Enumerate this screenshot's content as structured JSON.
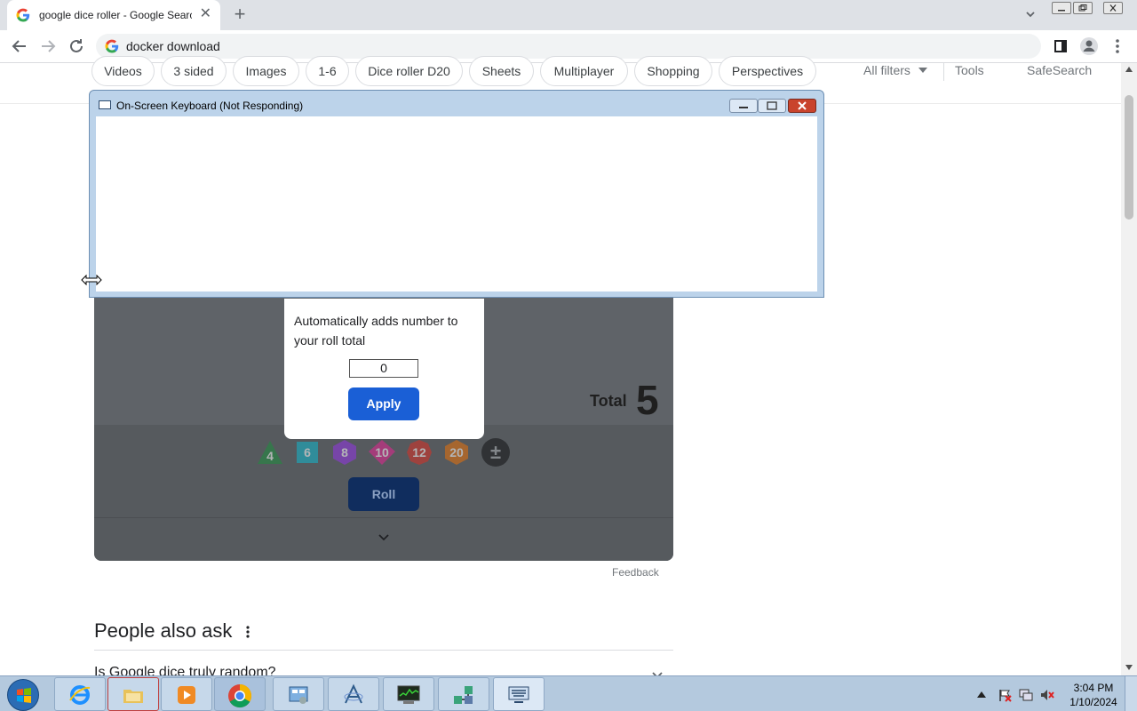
{
  "browser": {
    "tab_title": "google dice roller - Google Search",
    "tab_close": "✕",
    "new_tab": "+",
    "address": "docker download"
  },
  "filters": {
    "chips": [
      "Videos",
      "3 sided",
      "Images",
      "1-6",
      "Dice roller D20",
      "Sheets",
      "Multiplayer",
      "Shopping",
      "Perspectives"
    ],
    "all_filters": "All filters",
    "tools": "Tools",
    "safesearch": "SafeSearch"
  },
  "osk": {
    "title": "On-Screen Keyboard (Not Responding)"
  },
  "dice_roller": {
    "modifier_text": "Automatically adds number to your roll total",
    "modifier_value": "0",
    "apply_label": "Apply",
    "total_label": "Total",
    "total_value": "5",
    "dice": [
      {
        "label": "4",
        "shape": "triangle",
        "color": "#1e8e3e"
      },
      {
        "label": "6",
        "shape": "square",
        "color": "#12b5cb"
      },
      {
        "label": "8",
        "shape": "hexagon",
        "color": "#9334e6"
      },
      {
        "label": "10",
        "shape": "diamond",
        "color": "#e52592"
      },
      {
        "label": "12",
        "shape": "hexagon",
        "color": "#d93025"
      },
      {
        "label": "20",
        "shape": "hexagon",
        "color": "#e8710a"
      },
      {
        "label": "±",
        "shape": "circle",
        "color": "#3c4043"
      }
    ],
    "roll_label": "Roll"
  },
  "feedback": "Feedback",
  "people_also_ask": {
    "title": "People also ask",
    "question": "Is Google dice truly random?"
  },
  "taskbar": {
    "items": [
      "internet-explorer",
      "file-explorer",
      "media-player",
      "chrome",
      "control-panel",
      "tool-a",
      "task-manager",
      "network-app",
      "on-screen-keyboard"
    ],
    "time": "3:04 PM",
    "date": "1/10/2024"
  },
  "colors": {
    "apply_blue": "#1a5fd6",
    "roll_blue": "#102d5e",
    "card_gray": "#5f6368",
    "taskbar": "#b4c9de"
  }
}
